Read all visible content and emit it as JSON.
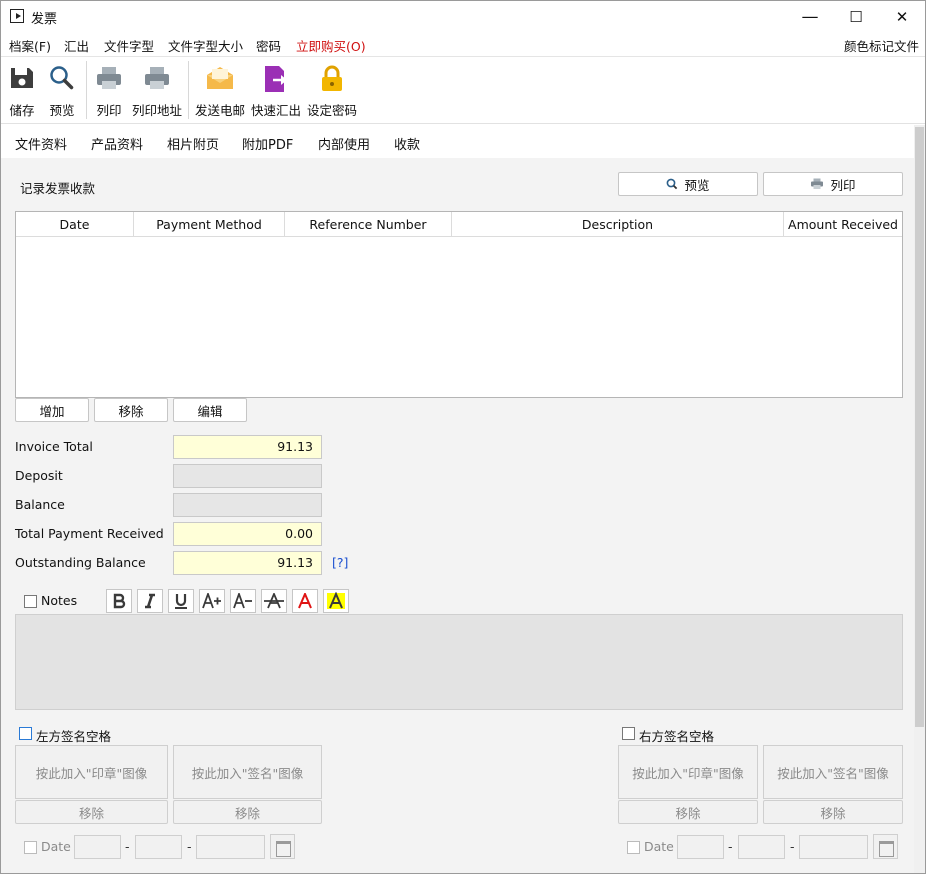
{
  "window": {
    "title": "发票",
    "minimize": "—",
    "maximize": "☐",
    "close": "✕"
  },
  "menubar": {
    "items": [
      "档案(F)",
      "汇出",
      "文件字型",
      "文件字型大小",
      "密码",
      "立即购买(O)"
    ],
    "right": "颜色标记文件",
    "accent": "#d01010"
  },
  "toolbar": {
    "save": "储存",
    "preview": "预览",
    "print": "列印",
    "print_address": "列印地址",
    "send_email": "发送电邮",
    "quick_export": "快速汇出",
    "set_password": "设定密码"
  },
  "tabs": [
    "文件资料",
    "产品资料",
    "相片附页",
    "附加PDF",
    "内部使用",
    "收款"
  ],
  "payments": {
    "heading": "记录发票收款",
    "preview_btn": "预览",
    "print_btn": "列印",
    "columns": [
      "Date",
      "Payment Method",
      "Reference Number",
      "Description",
      "Amount Received"
    ],
    "rows": [],
    "add_btn": "增加",
    "remove_btn": "移除",
    "edit_btn": "编辑"
  },
  "summary": {
    "invoice_total_label": "Invoice Total",
    "invoice_total": "91.13",
    "deposit_label": "Deposit",
    "deposit": "",
    "balance_label": "Balance",
    "balance": "",
    "total_received_label": "Total Payment Received",
    "total_received": "0.00",
    "outstanding_label": "Outstanding Balance",
    "outstanding": "91.13",
    "help": "[?]"
  },
  "notes": {
    "label": "Notes",
    "checked": false,
    "text": ""
  },
  "signature_left": {
    "label": "左方签名空格",
    "stamp_btn": "按此加入\"印章\"图像",
    "sign_btn": "按此加入\"签名\"图像",
    "remove": "移除",
    "date_label": "Date"
  },
  "signature_right": {
    "label": "右方签名空格",
    "stamp_btn": "按此加入\"印章\"图像",
    "sign_btn": "按此加入\"签名\"图像",
    "remove": "移除",
    "date_label": "Date"
  },
  "date_sep": "-"
}
